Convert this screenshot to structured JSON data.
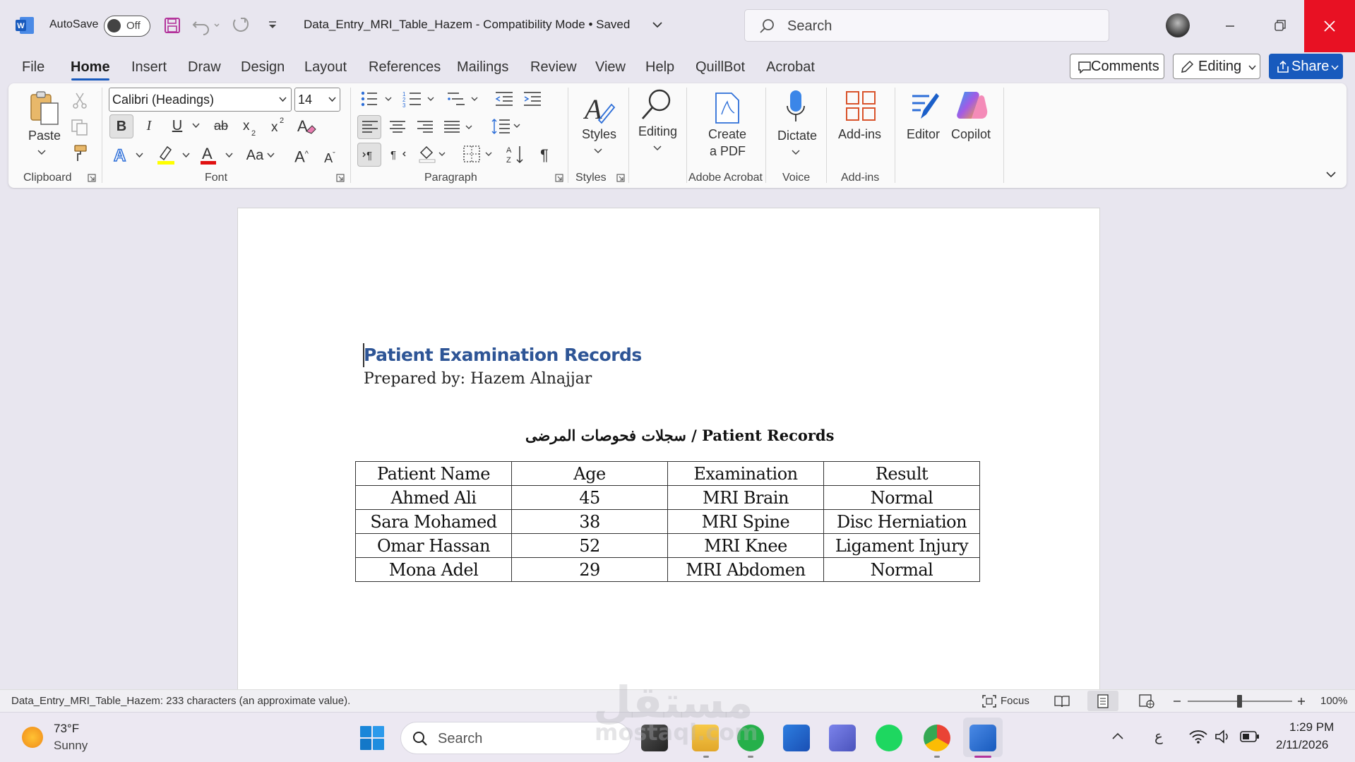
{
  "titlebar": {
    "autosave_label": "AutoSave",
    "autosave_state": "Off",
    "doc_title": "Data_Entry_MRI_Table_Hazem  -  Compatibility Mode • Saved",
    "search_placeholder": "Search"
  },
  "menu": {
    "items": [
      "File",
      "Home",
      "Insert",
      "Draw",
      "Design",
      "Layout",
      "References",
      "Mailings",
      "Review",
      "View",
      "Help",
      "QuillBot",
      "Acrobat"
    ],
    "comments": "Comments",
    "editing": "Editing",
    "share": "Share"
  },
  "ribbon": {
    "paste": "Paste",
    "clipboard": "Clipboard",
    "font_name": "Calibri (Headings)",
    "font_size": "14",
    "font_group": "Font",
    "paragraph_group": "Paragraph",
    "styles": "Styles",
    "styles_group": "Styles",
    "editing": "Editing",
    "create_pdf_1": "Create",
    "create_pdf_2": "a PDF",
    "adobe_group": "Adobe Acrobat",
    "dictate": "Dictate",
    "voice_group": "Voice",
    "addins": "Add-ins",
    "addins_group": "Add-ins",
    "editor": "Editor",
    "copilot": "Copilot",
    "bold": "B",
    "italic": "I",
    "underline": "U",
    "strike": "ab",
    "change_case": "Aa",
    "grow": "A",
    "shrink": "A"
  },
  "document": {
    "title": "Patient Examination Records",
    "prepared_by": "Prepared by: Hazem Alnajjar",
    "section_heading": "سجلات فحوصات المرضى / Patient Records",
    "table_header": [
      "Patient Name",
      "Age",
      "Examination",
      "Result"
    ],
    "table_rows": [
      [
        "Ahmed Ali",
        "45",
        "MRI Brain",
        "Normal"
      ],
      [
        "Sara Mohamed",
        "38",
        "MRI Spine",
        "Disc Herniation"
      ],
      [
        "Omar Hassan",
        "52",
        "MRI Knee",
        "Ligament Injury"
      ],
      [
        "Mona Adel",
        "29",
        "MRI Abdomen",
        "Normal"
      ]
    ]
  },
  "statusbar": {
    "word_count": "Data_Entry_MRI_Table_Hazem: 233 characters (an approximate value).",
    "focus": "Focus",
    "zoom": "100%"
  },
  "taskbar": {
    "weather_temp": "73°F",
    "weather_desc": "Sunny",
    "search": "Search",
    "lang": "ع",
    "time": "1:29 PM",
    "date": "2/11/2026"
  },
  "watermark": {
    "arabic": "مستقل",
    "latin": "mostaql.com"
  },
  "colors": {
    "accent": "#185abd",
    "title_blue": "#2e5596",
    "close_red": "#e81123"
  }
}
